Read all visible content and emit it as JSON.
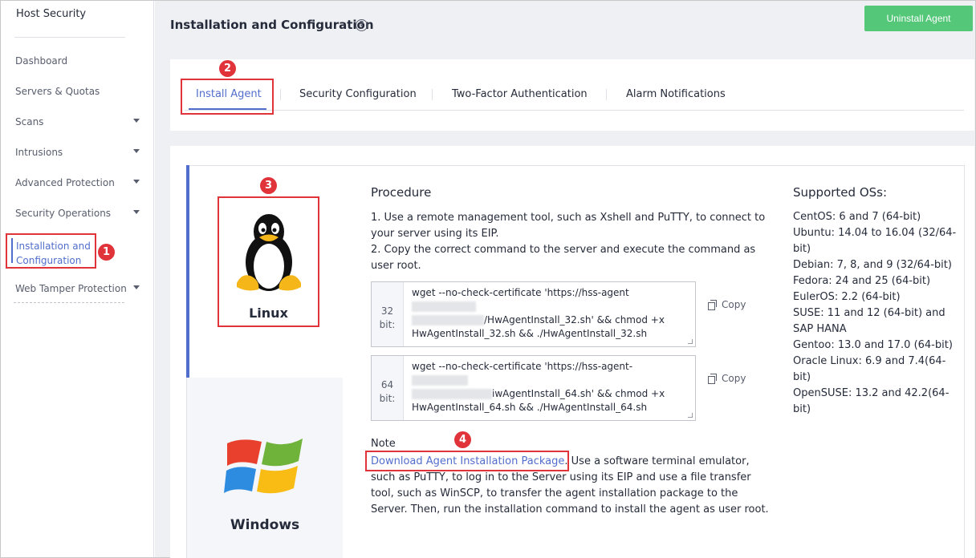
{
  "sidebar": {
    "title": "Host Security",
    "items": [
      {
        "label": "Dashboard"
      },
      {
        "label": "Servers & Quotas"
      },
      {
        "label": "Scans"
      },
      {
        "label": "Intrusions"
      },
      {
        "label": "Advanced Protection"
      },
      {
        "label": "Security Operations"
      },
      {
        "label": "Installation and Configuration"
      },
      {
        "label": "Web Tamper Protection"
      }
    ],
    "active_line1": "Installation and",
    "active_line2": "Configuration"
  },
  "header": {
    "title": "Installation and Configuration",
    "help_glyph": "?",
    "uninstall_label": "Uninstall Agent"
  },
  "tabs": [
    {
      "label": "Install Agent"
    },
    {
      "label": "Security Configuration"
    },
    {
      "label": "Two-Factor Authentication"
    },
    {
      "label": "Alarm Notifications"
    }
  ],
  "os_selector": {
    "linux_label": "Linux",
    "windows_label": "Windows"
  },
  "procedure": {
    "title": "Procedure",
    "steps": [
      "1. Use a remote management tool, such as Xshell and PuTTY, to connect to your server using its EIP.",
      "2. Copy the correct command to the server and execute the command as user root."
    ]
  },
  "commands": [
    {
      "arch_line1": "32",
      "arch_line2": "bit:",
      "line1": "wget --no-check-certificate 'https://hss-agent",
      "line2": "/HwAgentInstall_32.sh' && chmod +x",
      "line3": "HwAgentInstall_32.sh && ./HwAgentInstall_32.sh",
      "copy_label": "Copy"
    },
    {
      "arch_line1": "64",
      "arch_line2": "bit:",
      "line1": "wget --no-check-certificate 'https://hss-agent-",
      "line2": "iwAgentInstall_64.sh' && chmod +x",
      "line3": "HwAgentInstall_64.sh && ./HwAgentInstall_64.sh",
      "copy_label": "Copy"
    }
  ],
  "note": {
    "title": "Note",
    "link": "Download Agent Installation Package",
    "text": ". Use a software terminal emulator, such as PuTTY, to log in to the Server using its EIP and use a file transfer tool, such as WinSCP, to transfer the agent installation package to the Server. Then, run the installation command to install the agent as user root."
  },
  "supported": {
    "title": "Supported OSs:",
    "items": [
      "CentOS: 6 and 7 (64-bit)",
      "Ubuntu: 14.04 to 16.04 (32/64-bit)",
      "Debian: 7, 8, and 9 (32/64-bit)",
      "Fedora: 24 and 25 (64-bit)",
      "EulerOS: 2.2 (64-bit)",
      "SUSE: 11 and 12 (64-bit) and SAP HANA",
      "Gentoo: 13.0 and 17.0 (64-bit)",
      "Oracle Linux: 6.9 and 7.4(64-bit)",
      "OpenSUSE: 13.2 and 42.2(64-bit)"
    ]
  },
  "badges": [
    "1",
    "2",
    "3",
    "4"
  ],
  "colors": {
    "accent": "#526ecc",
    "highlight_box": "#e0333a",
    "uninstall_button": "#54c779"
  }
}
